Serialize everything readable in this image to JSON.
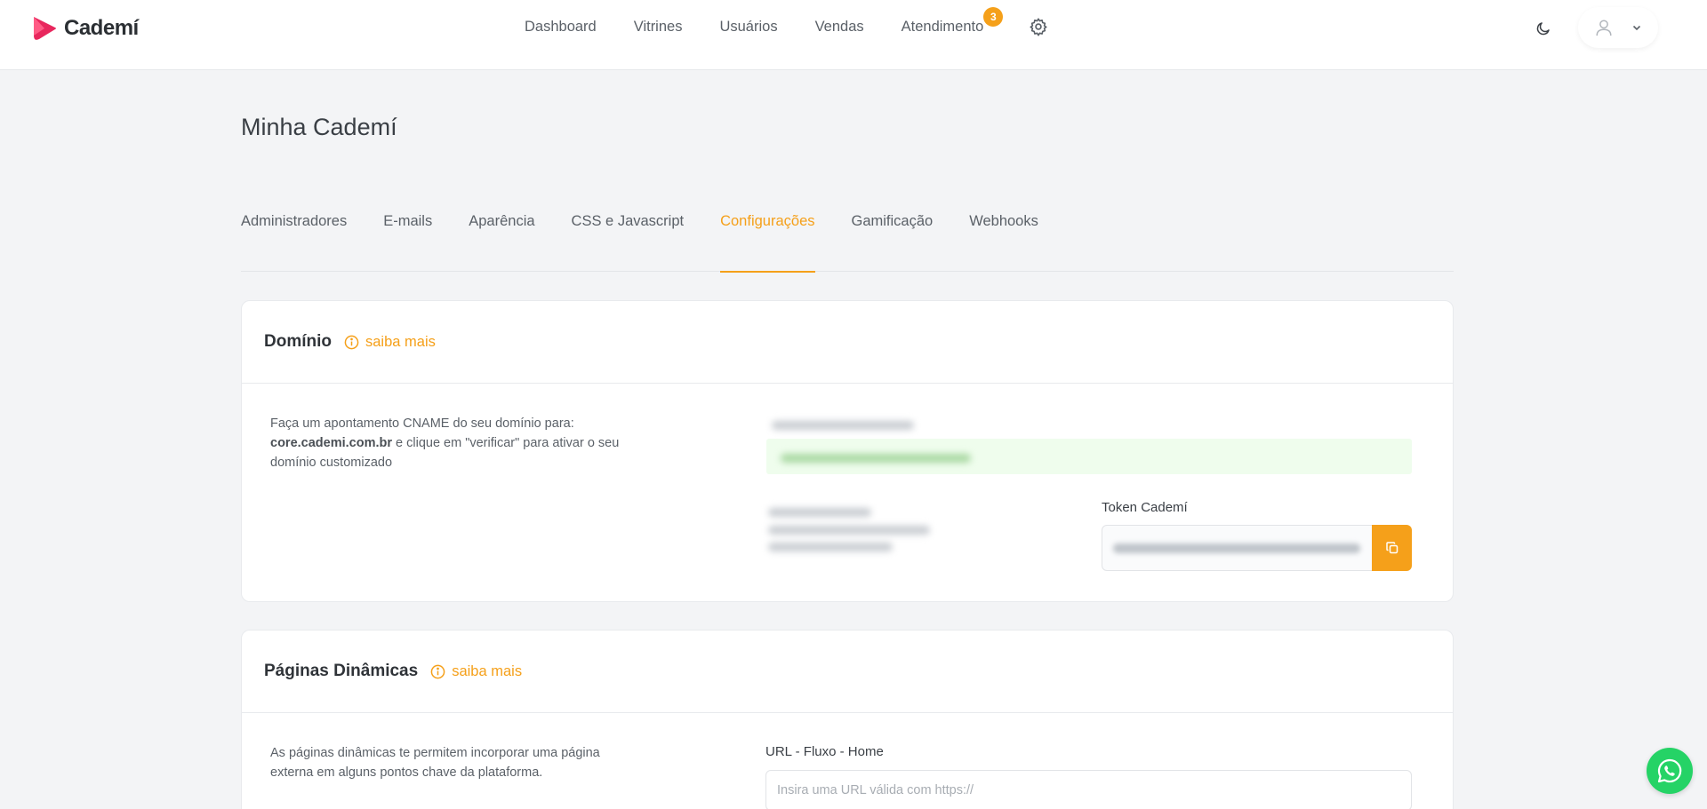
{
  "brand": {
    "name": "Cademí",
    "accent": "#f5a01a"
  },
  "nav": {
    "items": [
      {
        "label": "Dashboard"
      },
      {
        "label": "Vitrines"
      },
      {
        "label": "Usuários"
      },
      {
        "label": "Vendas"
      },
      {
        "label": "Atendimento",
        "badge": "3"
      }
    ],
    "settings_icon": "gear-icon",
    "theme_icon": "moon-icon",
    "user_icon": "user-icon",
    "user_chevron": "chevron-down-icon"
  },
  "page": {
    "title": "Minha Cademí"
  },
  "tabs": [
    {
      "label": "Administradores",
      "active": false
    },
    {
      "label": "E-mails",
      "active": false
    },
    {
      "label": "Aparência",
      "active": false
    },
    {
      "label": "CSS e Javascript",
      "active": false
    },
    {
      "label": "Configurações",
      "active": true
    },
    {
      "label": "Gamificação",
      "active": false
    },
    {
      "label": "Webhooks",
      "active": false
    }
  ],
  "domain_card": {
    "title": "Domínio",
    "saiba_mais": "saiba mais",
    "desc_prefix": "Faça um apontamento CNAME do seu domínio para:",
    "desc_domain": "core.cademi.com.br",
    "desc_suffix": " e clique em \"verificar\" para ativar o seu domínio customizado",
    "token_label": "Token Cademí"
  },
  "dynamic_card": {
    "title": "Páginas Dinâmicas",
    "saiba_mais": "saiba mais",
    "desc": "As páginas dinâmicas te permitem incorporar uma página externa em alguns pontos chave da plataforma.",
    "url_label": "URL - Fluxo - Home",
    "url_placeholder": "Insira uma URL válida com https://",
    "url_value": ""
  },
  "whatsapp": {
    "icon": "whatsapp-icon",
    "color": "#25d366"
  }
}
